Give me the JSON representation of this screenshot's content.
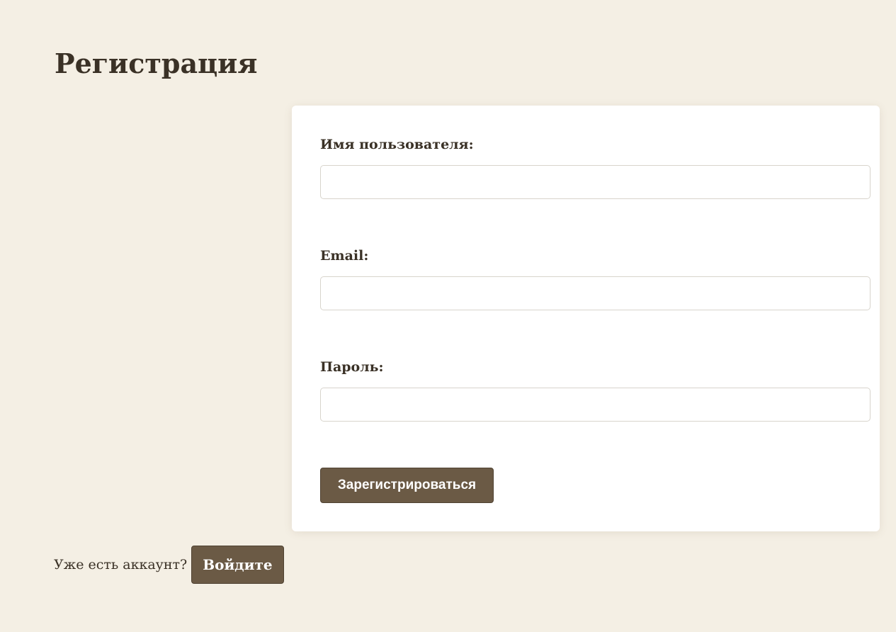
{
  "page": {
    "title": "Регистрация"
  },
  "form": {
    "username": {
      "label": "Имя пользователя:",
      "value": "",
      "placeholder": ""
    },
    "email": {
      "label": "Email:",
      "value": "",
      "placeholder": ""
    },
    "password": {
      "label": "Пароль:",
      "value": "",
      "placeholder": ""
    },
    "submit_label": "Зарегистрироваться"
  },
  "login": {
    "prompt": "Уже есть аккаунт?",
    "button_label": "Войдите"
  },
  "colors": {
    "background": "#f4efe4",
    "card": "#ffffff",
    "accent": "#6b5a45",
    "text": "#3a3126"
  }
}
